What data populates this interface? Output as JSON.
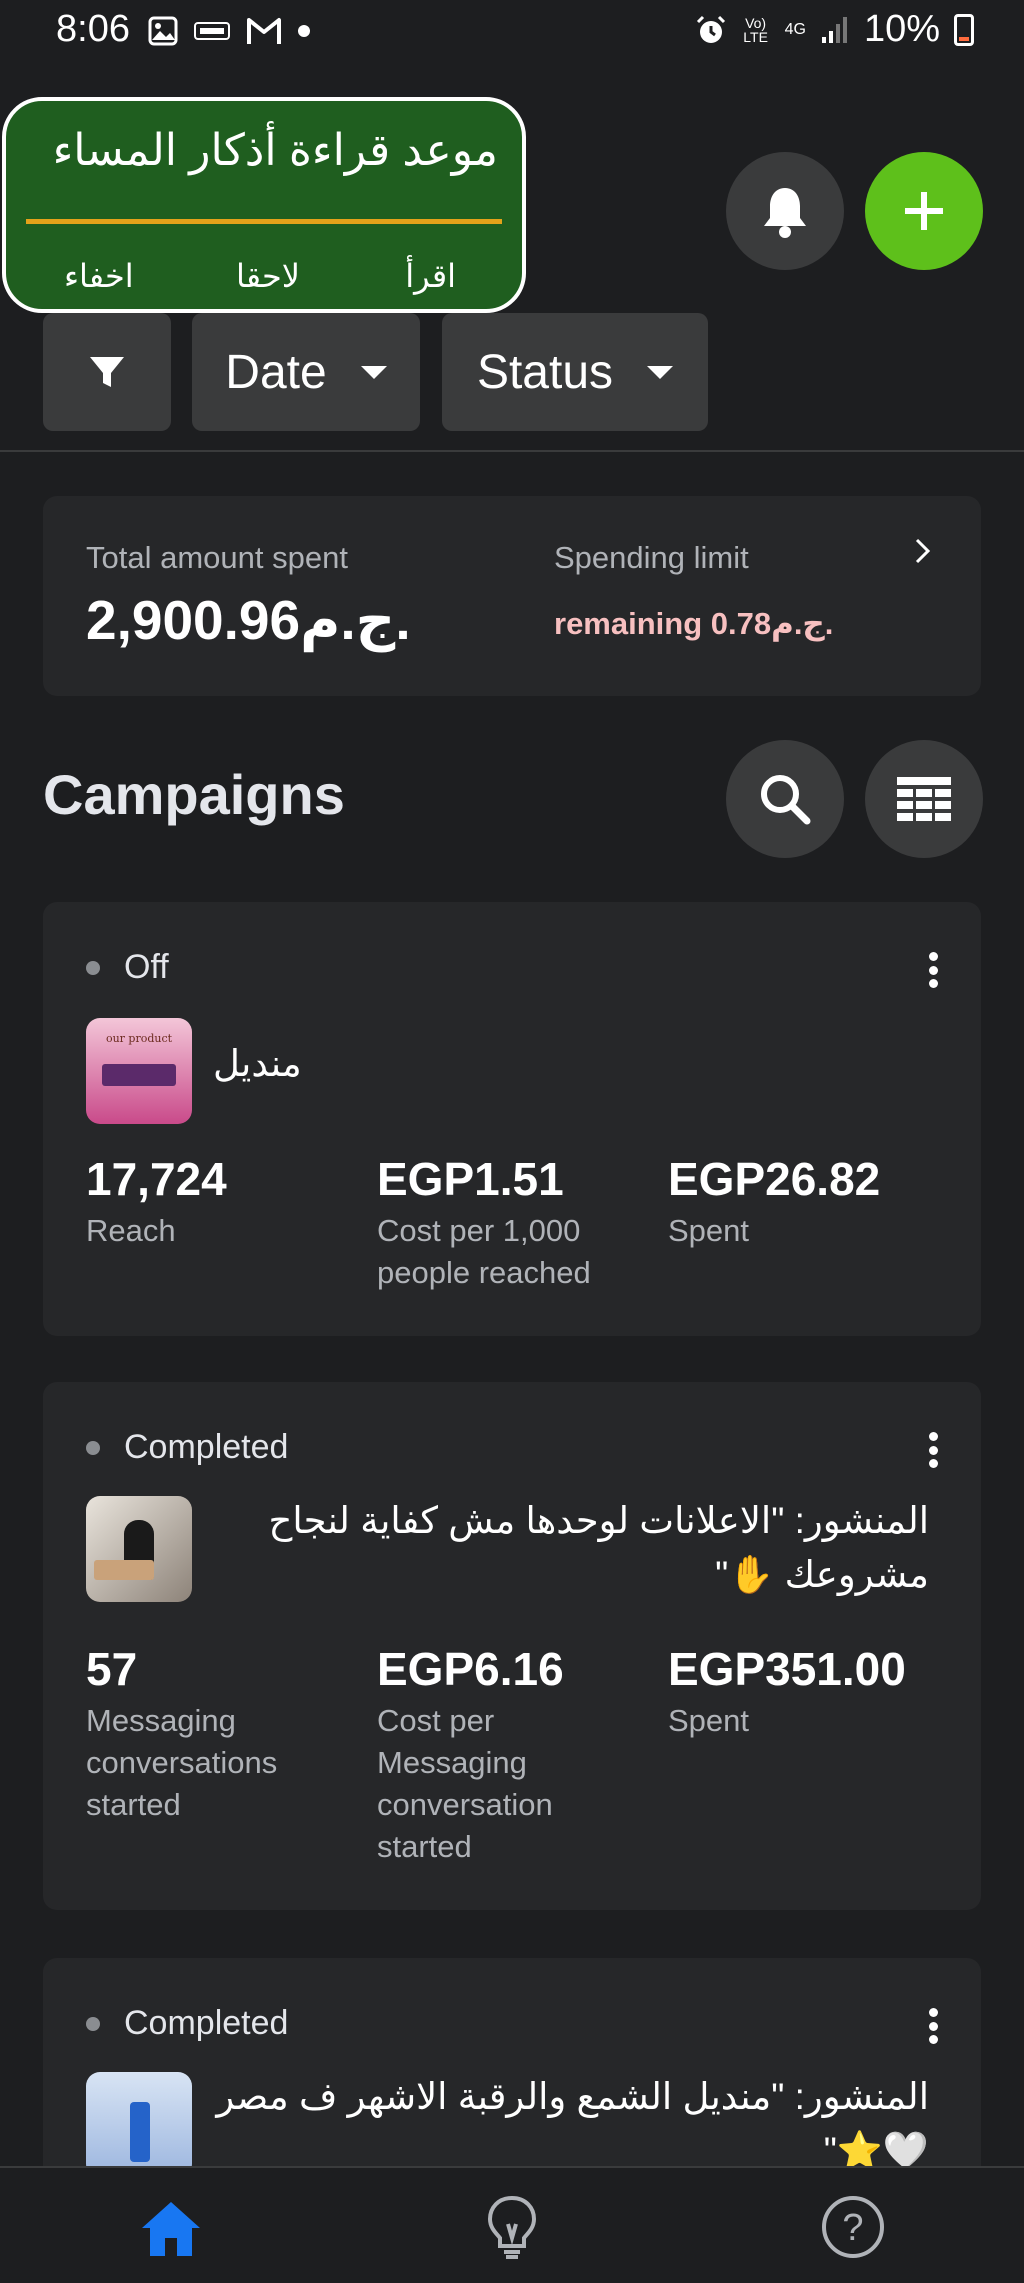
{
  "status_bar": {
    "time": "8:06",
    "left_icons": [
      "gallery-icon",
      "news-icon",
      "gmail-icon",
      "dot-icon"
    ],
    "right_icons": [
      "alarm-icon",
      "volte-icon",
      "4g-icon",
      "signal-icon"
    ],
    "volte": "Vo) LTE",
    "network": "4G",
    "battery": "10%"
  },
  "reminder": {
    "title": "موعد قراءة أذكار المساء",
    "read_label": "اقرأ",
    "later_label": "لاحقا",
    "hide_label": "اخفاء"
  },
  "filters": {
    "date_label": "Date",
    "status_label": "Status"
  },
  "summary": {
    "total_label": "Total amount spent",
    "total_value": "2,900.96ج.م.",
    "limit_label": "Spending limit",
    "remaining_text": "remaining 0.78ج.م."
  },
  "campaigns": {
    "title": "Campaigns",
    "items": [
      {
        "status": "Off",
        "name": "منديل",
        "thumb_text": "our product",
        "metrics": [
          {
            "value": "17,724",
            "label": "Reach"
          },
          {
            "value": "EGP1.51",
            "label": "Cost per 1,000 people reached"
          },
          {
            "value": "EGP26.82",
            "label": "Spent"
          }
        ]
      },
      {
        "status": "Completed",
        "name": "المنشور: \"الاعلانات لوحدها مش كفاية لنجاح مشروعك ✋\"",
        "metrics": [
          {
            "value": "57",
            "label": "Messaging conversations started"
          },
          {
            "value": "EGP6.16",
            "label": "Cost per Messaging conversation started"
          },
          {
            "value": "EGP351.00",
            "label": "Spent"
          }
        ]
      },
      {
        "status": "Completed",
        "name": "المنشور: \"منديل الشمع والرقبة الاشهر ف مصر 🤍⭐\""
      }
    ]
  },
  "bottom_nav": [
    "home-icon",
    "lightbulb-icon",
    "help-icon"
  ],
  "colors": {
    "background": "#1d1e20",
    "card": "#262729",
    "accent_green": "#5ec01b",
    "reminder_green": "#1f5e1f",
    "home_blue": "#1877f2"
  }
}
